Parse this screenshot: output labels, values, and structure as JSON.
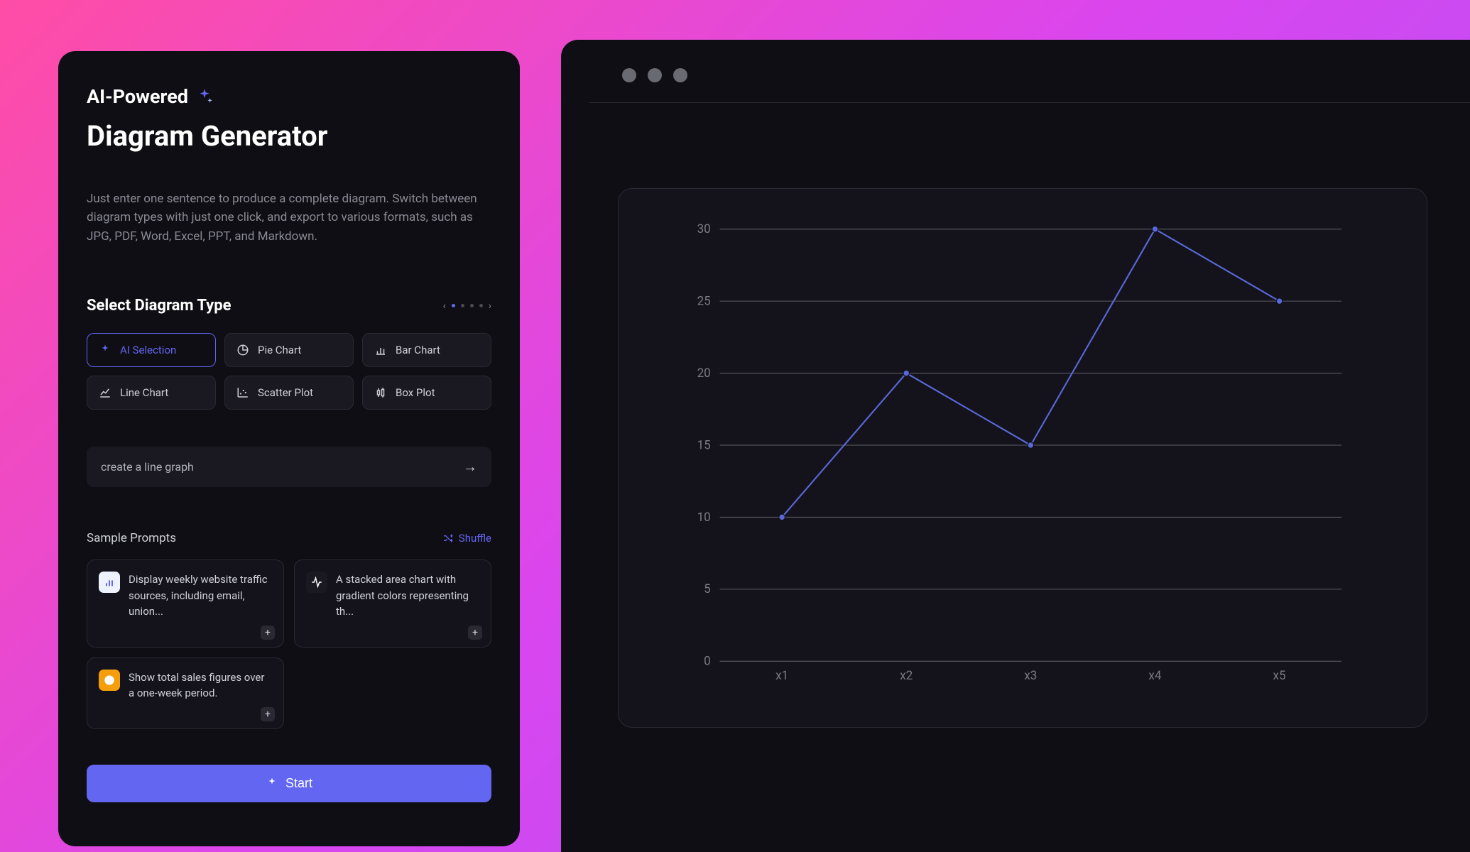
{
  "header": {
    "badge": "AI-Powered",
    "title": "Diagram Generator",
    "description": "Just enter one sentence to produce a complete diagram. Switch between diagram types with just one click, and export to various formats, such as JPG, PDF, Word, Excel, PPT, and Markdown."
  },
  "diagram_type": {
    "section_title": "Select Diagram Type",
    "options": [
      {
        "label": "AI Selection",
        "active": true
      },
      {
        "label": "Pie Chart",
        "active": false
      },
      {
        "label": "Bar Chart",
        "active": false
      },
      {
        "label": "Line Chart",
        "active": false
      },
      {
        "label": "Scatter Plot",
        "active": false
      },
      {
        "label": "Box Plot",
        "active": false
      }
    ]
  },
  "prompt": {
    "value": "create a line graph"
  },
  "samples": {
    "title": "Sample Prompts",
    "shuffle_label": "Shuffle",
    "items": [
      {
        "text": "Display weekly website traffic sources, including email, union..."
      },
      {
        "text": "A stacked area chart with gradient colors representing th..."
      },
      {
        "text": "Show total sales figures over a one-week period."
      }
    ]
  },
  "start_label": "Start",
  "chart_data": {
    "type": "line",
    "categories": [
      "x1",
      "x2",
      "x3",
      "x4",
      "x5"
    ],
    "values": [
      10,
      20,
      15,
      30,
      25
    ],
    "y_ticks": [
      0,
      5,
      10,
      15,
      20,
      25,
      30
    ],
    "ylim": [
      0,
      30
    ]
  },
  "colors": {
    "accent": "#6366f1",
    "line": "#5868d8",
    "panel_bg": "#0f0e14"
  }
}
